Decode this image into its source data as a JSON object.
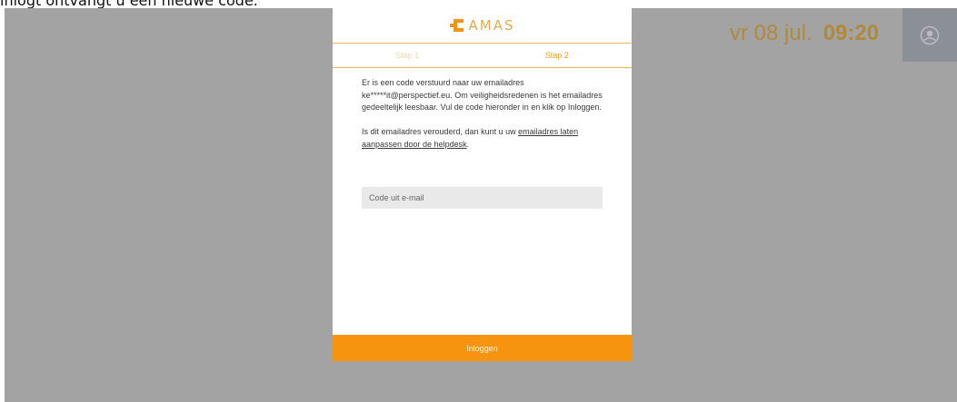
{
  "caption": "inlogt ontvangt u een nieuwe code.",
  "header": {
    "date": "vr 08 jul.",
    "time": "09:20"
  },
  "corner_icon": "user-icon",
  "card": {
    "logo_text": "AMAS",
    "steps": [
      {
        "label": "Stap 1"
      },
      {
        "label": "Stap 2"
      }
    ],
    "message_part1": "Er is een code verstuurd naar uw emailadres ke*****it@perspectief.eu. Om veiligheidsredenen is het emailadres gedeeltelijk leesbaar. Vul de code hieronder in en klik op Inloggen.",
    "message_part2": "Is dit emailadres verouderd, dan kunt u uw ",
    "link_text": "emailadres laten aanpassen door de helpdesk",
    "message_end": ".",
    "code_placeholder": "Code uit e-mail",
    "login_label": "Inloggen"
  },
  "colors": {
    "accent": "#f7940f",
    "backdrop": "#a3a3a3",
    "clock": "#b08a3a",
    "corner": "#8b9096"
  }
}
